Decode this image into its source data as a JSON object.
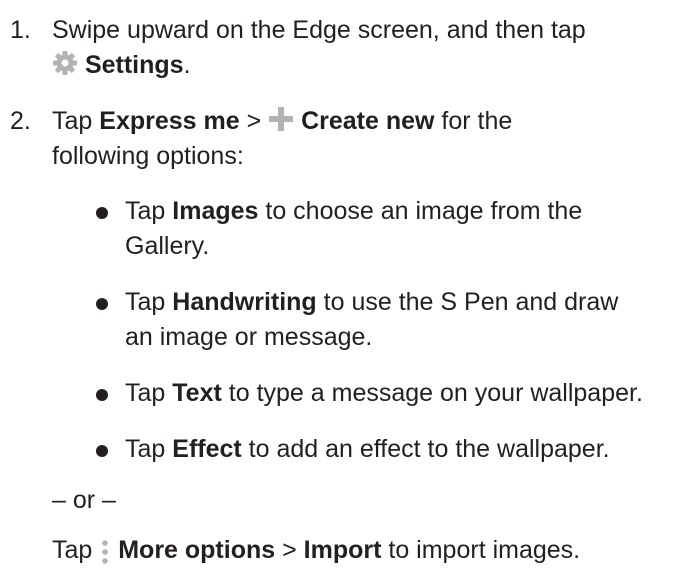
{
  "step1": {
    "number": "1.",
    "line1": "Swipe upward on the Edge screen, and then tap",
    "icon": "gear-icon",
    "settings": "Settings",
    "period": "."
  },
  "step2": {
    "number": "2.",
    "tap": "Tap ",
    "express_me": "Express me",
    "sep": " > ",
    "icon": "plus-icon",
    "create_new": "Create new",
    "rest1": " for the",
    "line2": "following options:"
  },
  "bullets": [
    {
      "tap": "Tap ",
      "bold": "Images",
      "rest": " to choose an image from the",
      "line2": "Gallery."
    },
    {
      "tap": "Tap ",
      "bold": "Handwriting",
      "rest": " to use the S Pen and draw",
      "line2": "an image or message."
    },
    {
      "tap": "Tap ",
      "bold": "Text",
      "rest": " to type a message on your wallpaper."
    },
    {
      "tap": "Tap ",
      "bold": "Effect",
      "rest": " to add an effect to the wallpaper."
    }
  ],
  "or_text": "– or –",
  "final": {
    "tap": "Tap ",
    "icon": "more-options-icon",
    "more_options": "More options",
    "sep": " > ",
    "import": "Import",
    "rest": " to import images."
  },
  "colors": {
    "text": "#231f20",
    "icon_gray": "#b3b3b3"
  }
}
